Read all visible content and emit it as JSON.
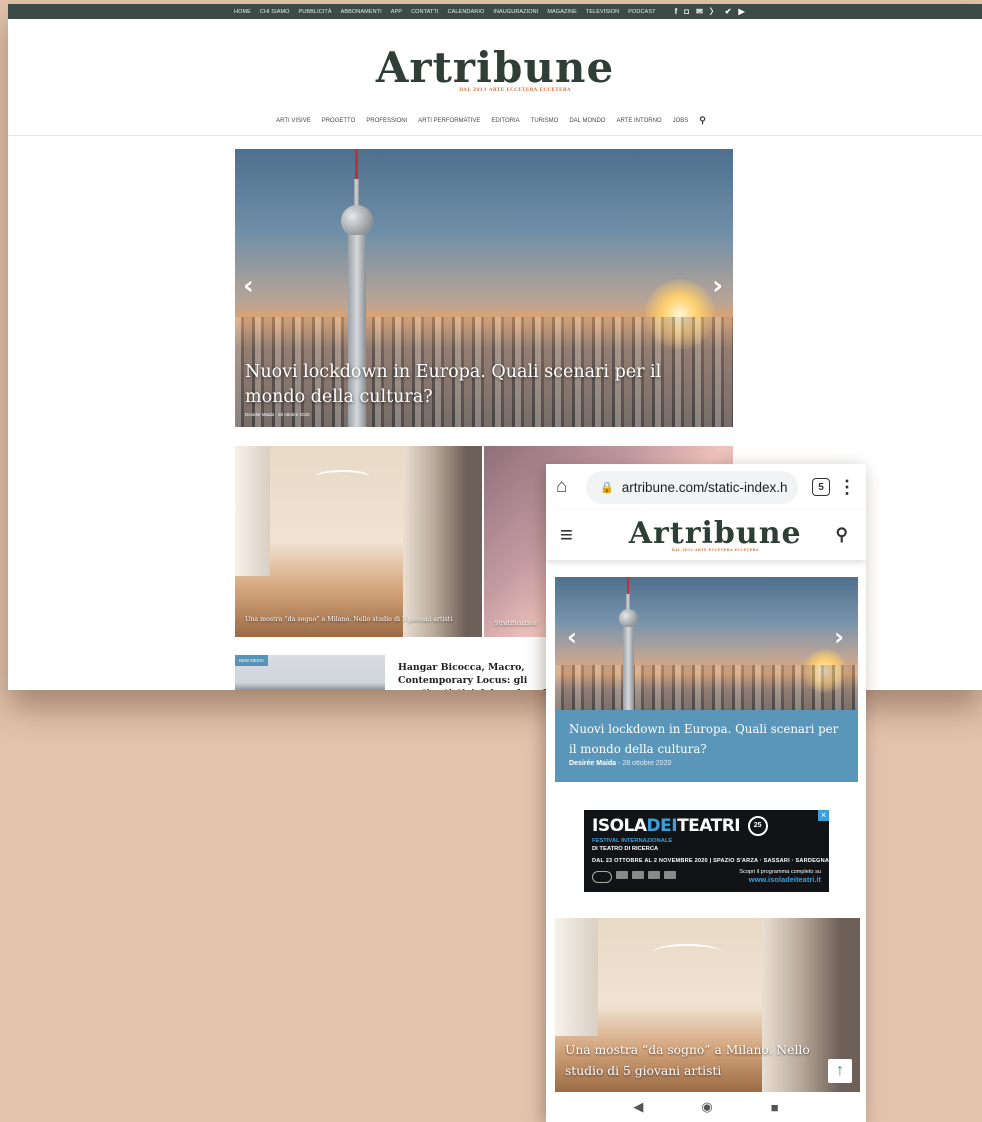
{
  "desktop": {
    "topbar": {
      "links": [
        "HOME",
        "CHI SIAMO",
        "PUBBLICITÀ",
        "ABBONAMENTI",
        "APP",
        "CONTATTI",
        "CALENDARIO",
        "INAUGURAZIONI",
        "MAGAZINE",
        "TELEVISION",
        "PODCAST"
      ],
      "socials": [
        "f",
        "◘",
        "✉",
        "〉",
        "✔",
        "▶"
      ],
      "color": "#3d4b47"
    },
    "logo": {
      "word": "Artribune",
      "tagline": "DAL 2011 ARTE ECCETERA ECCETERA"
    },
    "nav": {
      "items": [
        "ARTI VISIVE",
        "PROGETTO",
        "PROFESSIONI",
        "ARTI PERFORMATIVE",
        "EDITORIA",
        "TURISMO",
        "DAL MONDO",
        "ARTE INTORNO",
        "JOBS"
      ],
      "search_icon": "⚲"
    },
    "hero": {
      "title": "Nuovi lockdown in Europa. Quali scenari per il mondo della cultura?",
      "meta": "Desirée Maida  -  28 ottobre 2020",
      "prev": "‹",
      "next": "›"
    },
    "cards": [
      {
        "title": "Una mostra “da sogno” a Milano. Nello studio di 5 giovani artisti"
      },
      {
        "title": "Stratificazion"
      }
    ],
    "list": {
      "badge": "NEW MEDIA",
      "title": "Hangar Bicocca, Macro, Contemporary Locus: gli eventi artistici del week end"
    }
  },
  "mobile": {
    "browser": {
      "home_icon": "⌂",
      "lock_icon": "🔒",
      "url": "artribune.com/static-index.h",
      "tab_count": "5",
      "menu_icon": "⋮"
    },
    "header": {
      "menu_icon": "≡",
      "search_icon": "⚲"
    },
    "hero": {
      "title": "Nuovi lockdown in Europa. Quali scenari per il mondo della cultura?",
      "author": "Desirée Maida",
      "date": " - 28 ottobre 2020",
      "prev": "‹",
      "next": "›"
    },
    "ad": {
      "close": "×",
      "title_a": "ISOLA",
      "title_b": "DEI",
      "title_c": "TEATRI",
      "badge": "25",
      "festival_line1": "FESTIVAL INTERNAZIONALE",
      "festival_line2": "DI TEATRO DI RICERCA",
      "dates": "DAL 23 OTTOBRE AL 2 NOVEMBRE 2020 | SPAZIO S'ARZA · SASSARI · SARDEGNA",
      "program": "Scopri il programma completo su",
      "url": "www.isoladeiteatri.it"
    },
    "card": {
      "title": "Una mostra “da sogno” a Milano. Nello studio di 5 giovani artisti",
      "scroll_icon": "↑"
    },
    "androidnav": {
      "back": "◀",
      "home": "◉",
      "recent": "■"
    }
  }
}
